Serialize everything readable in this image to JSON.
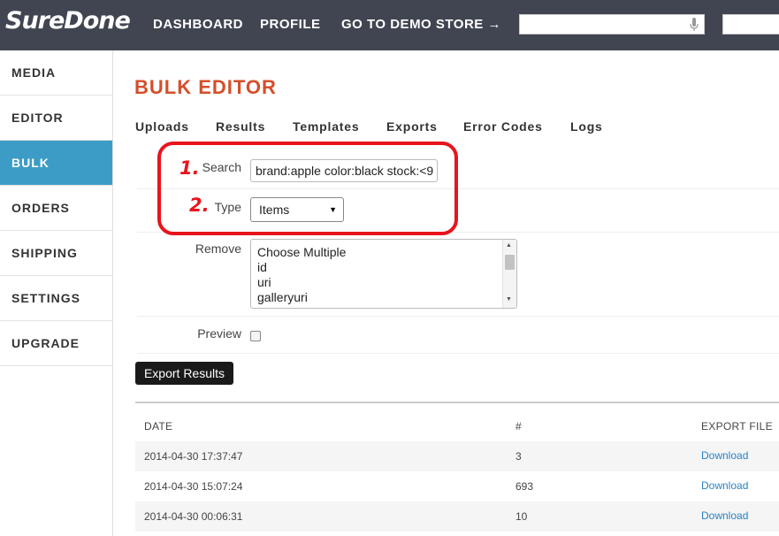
{
  "header": {
    "logo": "SureDone",
    "nav": [
      "DASHBOARD",
      "PROFILE",
      "GO TO DEMO STORE →"
    ]
  },
  "sidebar": {
    "items": [
      {
        "label": "MEDIA"
      },
      {
        "label": "EDITOR"
      },
      {
        "label": "BULK",
        "active": true
      },
      {
        "label": "ORDERS"
      },
      {
        "label": "SHIPPING"
      },
      {
        "label": "SETTINGS"
      },
      {
        "label": "UPGRADE"
      }
    ]
  },
  "main": {
    "title": "BULK EDITOR",
    "tabs": [
      "Uploads",
      "Results",
      "Templates",
      "Exports",
      "Error Codes",
      "Logs"
    ],
    "form": {
      "search_label": "Search",
      "search_value": "brand:apple color:black stock:<9",
      "type_label": "Type",
      "type_value": "Items",
      "remove_label": "Remove",
      "remove_options": [
        "Choose Multiple",
        "id",
        "uri",
        "galleryuri"
      ],
      "preview_label": "Preview",
      "export_button": "Export Results"
    },
    "annotations": {
      "step1": "1.",
      "step2": "2.",
      "highlight_color": "#e8141c"
    },
    "table": {
      "headers": [
        "DATE",
        "#",
        "EXPORT FILE"
      ],
      "rows": [
        {
          "date": "2014-04-30 17:37:47",
          "count": "3",
          "file": "Download"
        },
        {
          "date": "2014-04-30 15:07:24",
          "count": "693",
          "file": "Download"
        },
        {
          "date": "2014-04-30 00:06:31",
          "count": "10",
          "file": "Download"
        }
      ]
    }
  },
  "colors": {
    "header_bg": "#404551",
    "accent_active": "#3d9cc5",
    "title": "#d44f2b",
    "link": "#2a82c4"
  }
}
